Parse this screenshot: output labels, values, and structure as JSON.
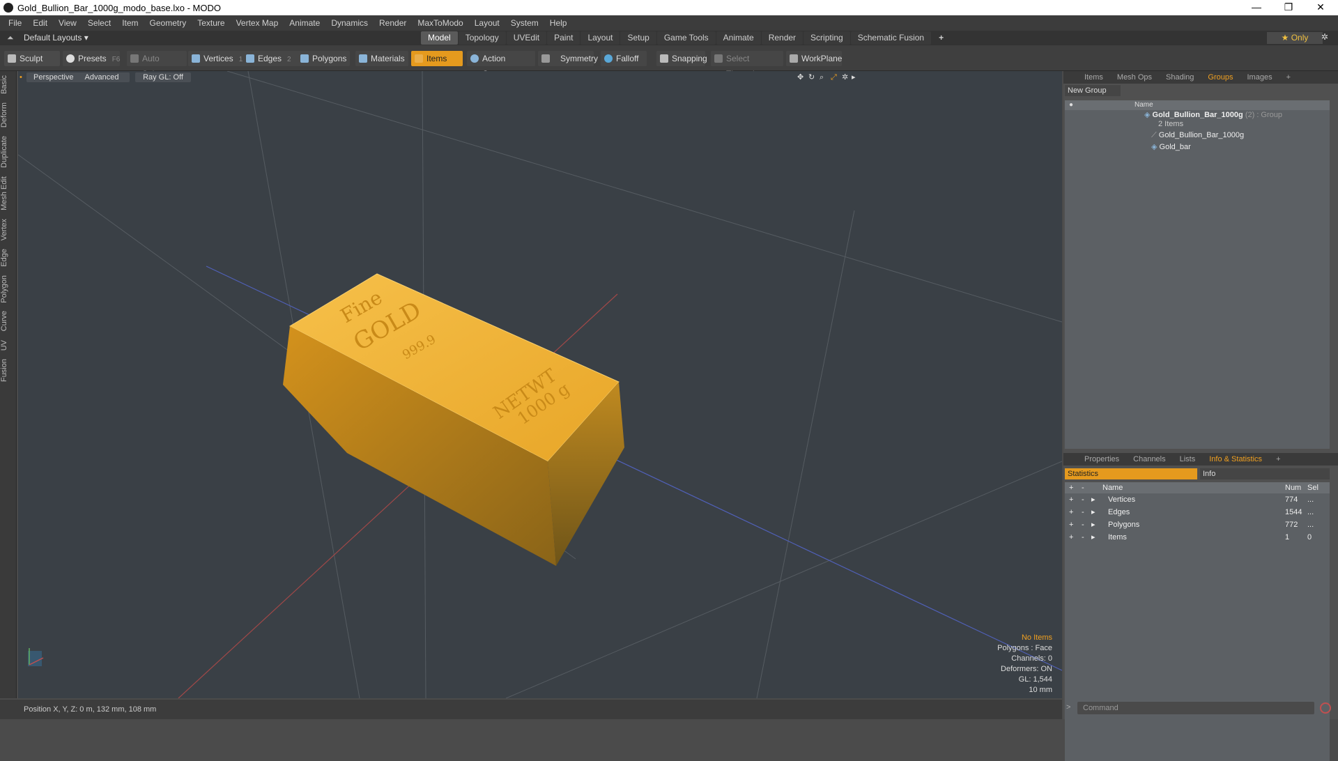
{
  "window": {
    "title": "Gold_Bullion_Bar_1000g_modo_base.lxo - MODO"
  },
  "menu": [
    "File",
    "Edit",
    "View",
    "Select",
    "Item",
    "Geometry",
    "Texture",
    "Vertex Map",
    "Animate",
    "Dynamics",
    "Render",
    "MaxToModo",
    "Layout",
    "System",
    "Help"
  ],
  "layoutbar": {
    "layout": "Default Layouts ▾",
    "tabs": [
      "Model",
      "Topology",
      "UVEdit",
      "Paint",
      "Layout",
      "Setup",
      "Game Tools",
      "Animate",
      "Render",
      "Scripting",
      "Schematic Fusion"
    ],
    "active_tab": "Model",
    "only": "★ Only"
  },
  "toolbar": {
    "sculpt": "Sculpt",
    "presets": "Presets",
    "presets_key": "F6",
    "auto_select": "Auto Select",
    "vertices": "Vertices",
    "vertices_key": "1",
    "edges": "Edges",
    "edges_key": "2",
    "polygons": "Polygons",
    "materials": "Materials",
    "items": "Items",
    "action_center": "Action Center",
    "symmetry": "Symmetry",
    "falloff": "Falloff",
    "snapping": "Snapping",
    "select_through": "Select Through",
    "workplane": "WorkPlane"
  },
  "leftstrip": [
    "Basic",
    "Deform",
    "Duplicate",
    "Mesh Edit",
    "Vertex",
    "Edge",
    "Polygon",
    "Curve",
    "UV",
    "Fusion"
  ],
  "viewport": {
    "perspective": "Perspective",
    "advanced": "Advanced",
    "raygl": "Ray GL: Off",
    "bar_text": {
      "fine": "Fine",
      "gold": "GOLD",
      "purity": "999.9",
      "netwt": "NETWT",
      "weight": "1000 g"
    },
    "info": {
      "no_items": "No Items",
      "polygons": "Polygons : Face",
      "channels": "Channels: 0",
      "deformers": "Deformers: ON",
      "gl": "GL: 1,544",
      "unit": "10 mm"
    }
  },
  "groups_panel": {
    "tabs": [
      "Items",
      "Mesh Ops",
      "Shading",
      "Groups",
      "Images"
    ],
    "active_tab": "Groups",
    "new_group": "New Group",
    "col_name": "Name",
    "group_name": "Gold_Bullion_Bar_1000g",
    "group_suffix": "(2) : Group",
    "group_count": "2 Items",
    "children": [
      "Gold_Bullion_Bar_1000g",
      "Gold_bar"
    ]
  },
  "stats_panel": {
    "tabs": [
      "Properties",
      "Channels",
      "Lists",
      "Info & Statistics"
    ],
    "active_tab": "Info & Statistics",
    "subtabs": [
      "Statistics",
      "Info"
    ],
    "cols": {
      "name": "Name",
      "num": "Num",
      "sel": "Sel"
    },
    "rows": [
      {
        "name": "Vertices",
        "num": "774",
        "sel": "..."
      },
      {
        "name": "Edges",
        "num": "1544",
        "sel": "..."
      },
      {
        "name": "Polygons",
        "num": "772",
        "sel": "..."
      },
      {
        "name": "Items",
        "num": "1",
        "sel": "0"
      }
    ]
  },
  "status": {
    "position": "Position X, Y, Z:   0 m, 132 mm, 108 mm"
  },
  "command": {
    "placeholder": "Command"
  },
  "colors": {
    "accent": "#e59a1e",
    "gold": "#e8a628",
    "viewport_bg": "#3a4046"
  }
}
